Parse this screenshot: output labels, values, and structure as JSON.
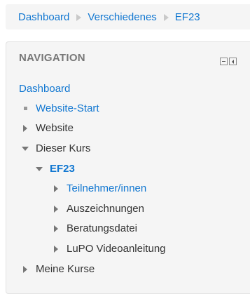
{
  "breadcrumb": {
    "items": [
      "Dashboard",
      "Verschiedenes",
      "EF23"
    ]
  },
  "navigation": {
    "title": "NAVIGATION",
    "root_label": "Dashboard",
    "items": [
      {
        "label": "Website-Start",
        "icon": "square-bullet-icon"
      },
      {
        "label": "Website",
        "icon": "expand-arrow-icon"
      },
      {
        "label": "Dieser Kurs",
        "icon": "collapse-arrow-icon"
      },
      {
        "label": "EF23",
        "icon": "collapse-arrow-icon"
      },
      {
        "label": "Teilnehmer/innen",
        "icon": "expand-arrow-icon"
      },
      {
        "label": "Auszeichnungen",
        "icon": "expand-arrow-icon"
      },
      {
        "label": "Beratungsdatei",
        "icon": "expand-arrow-icon"
      },
      {
        "label": "LuPO Videoanleitung",
        "icon": "expand-arrow-icon"
      },
      {
        "label": "Meine Kurse",
        "icon": "expand-arrow-icon"
      }
    ]
  },
  "colors": {
    "link": "#1177d1",
    "text": "#333333",
    "title": "#777777",
    "panel_bg": "#f5f5f5"
  }
}
